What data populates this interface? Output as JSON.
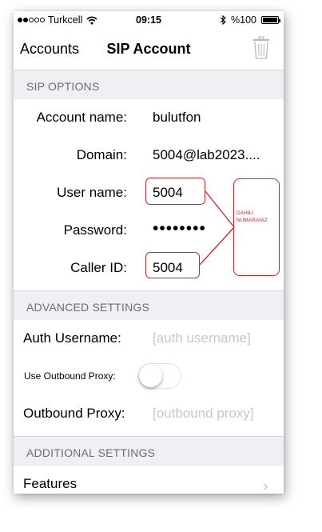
{
  "status_bar": {
    "carrier": "Turkcell",
    "time": "09:15",
    "battery": "%100"
  },
  "nav": {
    "back_label": "Accounts",
    "title": "SIP Account"
  },
  "sip_options": {
    "header": "SIP OPTIONS",
    "account_name_label": "Account name:",
    "account_name_value": "bulutfon",
    "domain_label": "Domain:",
    "domain_value": "5004@lab2023....",
    "username_label": "User name:",
    "username_value": "5004",
    "password_label": "Password:",
    "password_value": "••••••••",
    "callerid_label": "Caller ID:",
    "callerid_value": "5004"
  },
  "advanced": {
    "header": "ADVANCED SETTINGS",
    "auth_label": "Auth Username:",
    "auth_placeholder": "[auth username]",
    "use_proxy_label": "Use Outbound Proxy:",
    "use_proxy_enabled": false,
    "proxy_label": "Outbound Proxy:",
    "proxy_placeholder": "[outbound proxy]"
  },
  "additional": {
    "header": "ADDITIONAL SETTINGS",
    "features_label": "Features"
  },
  "annotation": {
    "line1": "DAHİLİ",
    "line2": "NUMARANIZ"
  },
  "colors": {
    "annotation_red": "#c1272d",
    "section_bg": "#efeff4",
    "placeholder": "#c7c7cd"
  }
}
